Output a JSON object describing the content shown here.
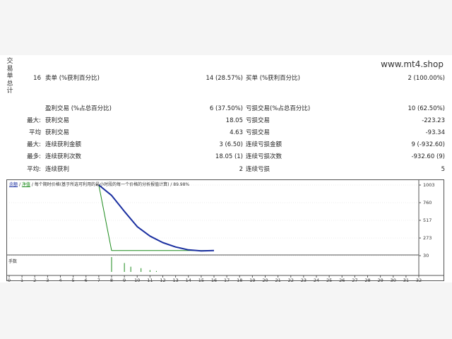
{
  "report": {
    "title_vertical": [
      "交",
      "易",
      "单",
      "总",
      "计"
    ],
    "site": "www.mt4.shop",
    "rows": [
      {
        "c1": "16",
        "c2": "卖单 (%获利百分比)",
        "c3": "14 (28.57%)",
        "c4": "买单 (%获利百分比)",
        "c5": "2 (100.00%)"
      },
      {
        "c1": "",
        "c2": "盈利交易 (%占总百分比)",
        "c3": "6 (37.50%)",
        "c4": "亏损交易(%占总百分比)",
        "c5": "10 (62.50%)"
      },
      {
        "c1": "最大:",
        "c2": "获利交易",
        "c3": "18.05",
        "c4": "亏损交易",
        "c5": "-223.23"
      },
      {
        "c1": "平均",
        "c2": "获利交易",
        "c3": "4.63",
        "c4": "亏损交易",
        "c5": "-93.34"
      },
      {
        "c1": "最大:",
        "c2": "连续获利金额",
        "c3": "3 (6.50)",
        "c4": "连续亏损金额",
        "c5": "9 (-932.60)"
      },
      {
        "c1": "最多:",
        "c2": "连续获利次数",
        "c3": "18.05 (1)",
        "c4": "连续亏损次数",
        "c5": "-932.60 (9)"
      },
      {
        "c1": "平均:",
        "c2": "连续获利",
        "c3": "2",
        "c4": "连续亏损",
        "c5": "5"
      }
    ]
  },
  "chart": {
    "legend_balance": "余额",
    "legend_equity": "净值",
    "legend_text": " / 每个期时价格(基于所选可利用的最小时段的每一个价格的分析报值计算) / 89.98%",
    "lots_label": "手数",
    "colors": {
      "balance": "#1a2fa0",
      "equity": "#1b8a1b",
      "lots": "#1b8a1b",
      "grid": "#d8d8d8"
    }
  },
  "chart_data": {
    "type": "line",
    "x": [
      7,
      8,
      9,
      10,
      11,
      12,
      13,
      14,
      15,
      16
    ],
    "series": [
      {
        "values": [
          1003,
          860,
          640,
          430,
          300,
          210,
          150,
          110,
          95,
          100
        ]
      },
      {
        "values": [
          1003,
          100,
          100,
          100,
          100,
          100,
          100,
          100,
          100,
          100
        ]
      }
    ],
    "lots": {
      "x": [
        8,
        9,
        9.5,
        10.3,
        11,
        11.5
      ],
      "values": [
        1.0,
        0.6,
        0.35,
        0.25,
        0.12,
        0.06
      ]
    },
    "yticks": [
      "1003",
      "760",
      "517",
      "273",
      "30"
    ],
    "ylim": [
      30,
      1003
    ],
    "xticks": [
      "0",
      "1",
      "2",
      "3",
      "4",
      "5",
      "6",
      "7",
      "8",
      "9",
      "10",
      "11",
      "12",
      "13",
      "14",
      "15",
      "16",
      "17",
      "18",
      "19",
      "20",
      "21",
      "22",
      "23",
      "24",
      "25",
      "26",
      "27",
      "28",
      "29",
      "30",
      "31",
      "32"
    ],
    "xlim": [
      0,
      32
    ]
  }
}
